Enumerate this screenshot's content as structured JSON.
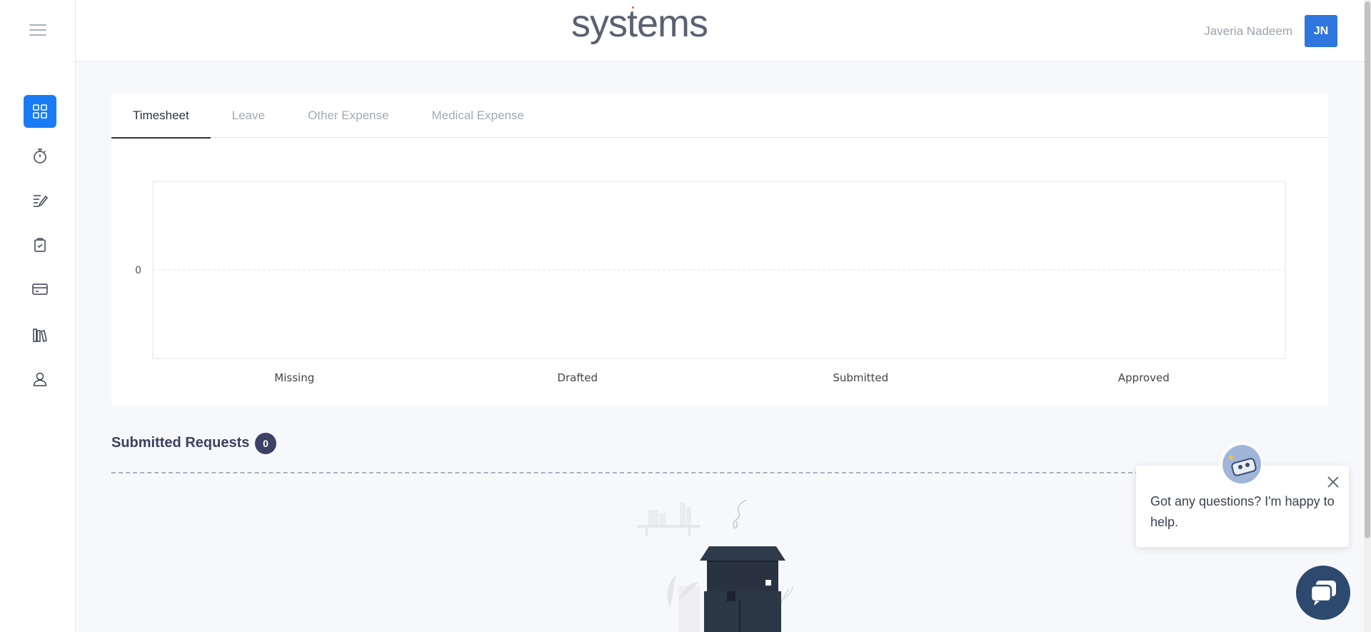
{
  "header": {
    "logo_text": "systems",
    "user_name": "Javeria Nadeem",
    "user_initials": "JN"
  },
  "sidebar": {
    "items": [
      {
        "name": "dashboard",
        "icon": "grid-icon",
        "active": true
      },
      {
        "name": "timesheet",
        "icon": "stopwatch-icon",
        "active": false
      },
      {
        "name": "requests",
        "icon": "list-pen-icon",
        "active": false
      },
      {
        "name": "leave",
        "icon": "clipboard-icon",
        "active": false
      },
      {
        "name": "expense",
        "icon": "card-icon",
        "active": false
      },
      {
        "name": "library",
        "icon": "books-icon",
        "active": false
      },
      {
        "name": "profile",
        "icon": "user-icon",
        "active": false
      }
    ]
  },
  "tabs": [
    {
      "label": "Timesheet",
      "active": true
    },
    {
      "label": "Leave",
      "active": false
    },
    {
      "label": "Other Expense",
      "active": false
    },
    {
      "label": "Medical Expense",
      "active": false
    }
  ],
  "chart_data": {
    "type": "bar",
    "categories": [
      "Missing",
      "Drafted",
      "Submitted",
      "Approved"
    ],
    "values": [
      0,
      0,
      0,
      0
    ],
    "y_ticks": [
      "0"
    ],
    "grid": true,
    "title": "",
    "xlabel": "",
    "ylabel": ""
  },
  "submitted_requests": {
    "title": "Submitted Requests",
    "count": "0"
  },
  "chat": {
    "message": "Got any questions? I'm happy to help."
  },
  "colors": {
    "accent": "#1a7cf5",
    "avatar_bg": "#2f76de",
    "badge_bg": "#3c4264",
    "chat_button": "#2d4a6e"
  }
}
